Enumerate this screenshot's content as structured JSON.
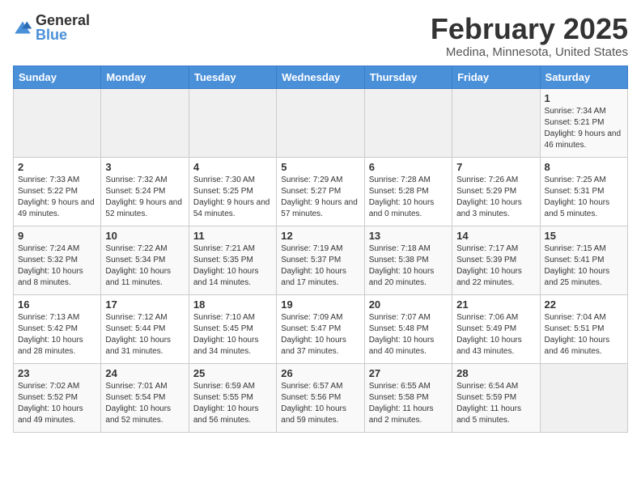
{
  "header": {
    "logo_general": "General",
    "logo_blue": "Blue",
    "title": "February 2025",
    "subtitle": "Medina, Minnesota, United States"
  },
  "weekdays": [
    "Sunday",
    "Monday",
    "Tuesday",
    "Wednesday",
    "Thursday",
    "Friday",
    "Saturday"
  ],
  "weeks": [
    [
      {
        "day": "",
        "info": ""
      },
      {
        "day": "",
        "info": ""
      },
      {
        "day": "",
        "info": ""
      },
      {
        "day": "",
        "info": ""
      },
      {
        "day": "",
        "info": ""
      },
      {
        "day": "",
        "info": ""
      },
      {
        "day": "1",
        "info": "Sunrise: 7:34 AM\nSunset: 5:21 PM\nDaylight: 9 hours and 46 minutes."
      }
    ],
    [
      {
        "day": "2",
        "info": "Sunrise: 7:33 AM\nSunset: 5:22 PM\nDaylight: 9 hours and 49 minutes."
      },
      {
        "day": "3",
        "info": "Sunrise: 7:32 AM\nSunset: 5:24 PM\nDaylight: 9 hours and 52 minutes."
      },
      {
        "day": "4",
        "info": "Sunrise: 7:30 AM\nSunset: 5:25 PM\nDaylight: 9 hours and 54 minutes."
      },
      {
        "day": "5",
        "info": "Sunrise: 7:29 AM\nSunset: 5:27 PM\nDaylight: 9 hours and 57 minutes."
      },
      {
        "day": "6",
        "info": "Sunrise: 7:28 AM\nSunset: 5:28 PM\nDaylight: 10 hours and 0 minutes."
      },
      {
        "day": "7",
        "info": "Sunrise: 7:26 AM\nSunset: 5:29 PM\nDaylight: 10 hours and 3 minutes."
      },
      {
        "day": "8",
        "info": "Sunrise: 7:25 AM\nSunset: 5:31 PM\nDaylight: 10 hours and 5 minutes."
      }
    ],
    [
      {
        "day": "9",
        "info": "Sunrise: 7:24 AM\nSunset: 5:32 PM\nDaylight: 10 hours and 8 minutes."
      },
      {
        "day": "10",
        "info": "Sunrise: 7:22 AM\nSunset: 5:34 PM\nDaylight: 10 hours and 11 minutes."
      },
      {
        "day": "11",
        "info": "Sunrise: 7:21 AM\nSunset: 5:35 PM\nDaylight: 10 hours and 14 minutes."
      },
      {
        "day": "12",
        "info": "Sunrise: 7:19 AM\nSunset: 5:37 PM\nDaylight: 10 hours and 17 minutes."
      },
      {
        "day": "13",
        "info": "Sunrise: 7:18 AM\nSunset: 5:38 PM\nDaylight: 10 hours and 20 minutes."
      },
      {
        "day": "14",
        "info": "Sunrise: 7:17 AM\nSunset: 5:39 PM\nDaylight: 10 hours and 22 minutes."
      },
      {
        "day": "15",
        "info": "Sunrise: 7:15 AM\nSunset: 5:41 PM\nDaylight: 10 hours and 25 minutes."
      }
    ],
    [
      {
        "day": "16",
        "info": "Sunrise: 7:13 AM\nSunset: 5:42 PM\nDaylight: 10 hours and 28 minutes."
      },
      {
        "day": "17",
        "info": "Sunrise: 7:12 AM\nSunset: 5:44 PM\nDaylight: 10 hours and 31 minutes."
      },
      {
        "day": "18",
        "info": "Sunrise: 7:10 AM\nSunset: 5:45 PM\nDaylight: 10 hours and 34 minutes."
      },
      {
        "day": "19",
        "info": "Sunrise: 7:09 AM\nSunset: 5:47 PM\nDaylight: 10 hours and 37 minutes."
      },
      {
        "day": "20",
        "info": "Sunrise: 7:07 AM\nSunset: 5:48 PM\nDaylight: 10 hours and 40 minutes."
      },
      {
        "day": "21",
        "info": "Sunrise: 7:06 AM\nSunset: 5:49 PM\nDaylight: 10 hours and 43 minutes."
      },
      {
        "day": "22",
        "info": "Sunrise: 7:04 AM\nSunset: 5:51 PM\nDaylight: 10 hours and 46 minutes."
      }
    ],
    [
      {
        "day": "23",
        "info": "Sunrise: 7:02 AM\nSunset: 5:52 PM\nDaylight: 10 hours and 49 minutes."
      },
      {
        "day": "24",
        "info": "Sunrise: 7:01 AM\nSunset: 5:54 PM\nDaylight: 10 hours and 52 minutes."
      },
      {
        "day": "25",
        "info": "Sunrise: 6:59 AM\nSunset: 5:55 PM\nDaylight: 10 hours and 56 minutes."
      },
      {
        "day": "26",
        "info": "Sunrise: 6:57 AM\nSunset: 5:56 PM\nDaylight: 10 hours and 59 minutes."
      },
      {
        "day": "27",
        "info": "Sunrise: 6:55 AM\nSunset: 5:58 PM\nDaylight: 11 hours and 2 minutes."
      },
      {
        "day": "28",
        "info": "Sunrise: 6:54 AM\nSunset: 5:59 PM\nDaylight: 11 hours and 5 minutes."
      },
      {
        "day": "",
        "info": ""
      }
    ]
  ]
}
